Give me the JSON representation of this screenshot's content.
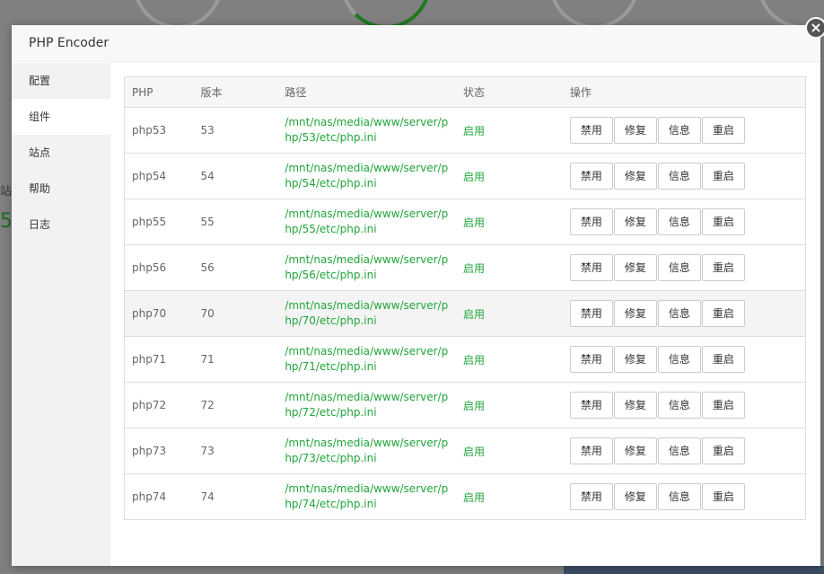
{
  "modal": {
    "title": "PHP Encoder",
    "close_glyph": "×"
  },
  "sidebar": {
    "items": [
      {
        "label": "配置"
      },
      {
        "label": "组件"
      },
      {
        "label": "站点"
      },
      {
        "label": "帮助"
      },
      {
        "label": "日志"
      }
    ],
    "active_index": 1
  },
  "background": {
    "left_text": "站",
    "left_num": "5"
  },
  "table": {
    "headers": [
      "PHP",
      "版本",
      "路径",
      "状态",
      "操作"
    ],
    "actions": [
      "禁用",
      "修复",
      "信息",
      "重启"
    ],
    "rows": [
      {
        "php": "php53",
        "version": "53",
        "path": "/mnt/nas/media/www/server/php/53/etc/php.ini",
        "status": "启用"
      },
      {
        "php": "php54",
        "version": "54",
        "path": "/mnt/nas/media/www/server/php/54/etc/php.ini",
        "status": "启用"
      },
      {
        "php": "php55",
        "version": "55",
        "path": "/mnt/nas/media/www/server/php/55/etc/php.ini",
        "status": "启用"
      },
      {
        "php": "php56",
        "version": "56",
        "path": "/mnt/nas/media/www/server/php/56/etc/php.ini",
        "status": "启用"
      },
      {
        "php": "php70",
        "version": "70",
        "path": "/mnt/nas/media/www/server/php/70/etc/php.ini",
        "status": "启用"
      },
      {
        "php": "php71",
        "version": "71",
        "path": "/mnt/nas/media/www/server/php/71/etc/php.ini",
        "status": "启用"
      },
      {
        "php": "php72",
        "version": "72",
        "path": "/mnt/nas/media/www/server/php/72/etc/php.ini",
        "status": "启用"
      },
      {
        "php": "php73",
        "version": "73",
        "path": "/mnt/nas/media/www/server/php/73/etc/php.ini",
        "status": "启用"
      },
      {
        "php": "php74",
        "version": "74",
        "path": "/mnt/nas/media/www/server/php/74/etc/php.ini",
        "status": "启用"
      }
    ],
    "hover_row_index": 4
  },
  "colors": {
    "accent_green": "#20a53a",
    "overlay": "#808080"
  }
}
